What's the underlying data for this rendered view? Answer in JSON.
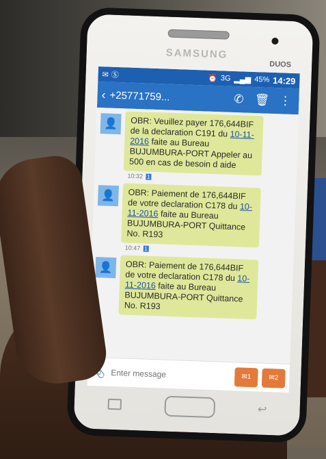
{
  "phone": {
    "brand": "SAMSUNG",
    "model_badge": "DUOS"
  },
  "status_bar": {
    "battery": "45%",
    "time": "14:29",
    "network": "3G"
  },
  "toolbar": {
    "back": "‹",
    "contact": "+25771759...",
    "icons": [
      "phone-icon",
      "trash-icon",
      "more-icon"
    ]
  },
  "messages": [
    {
      "lines_before_date": "OBR: Veuillez payer 176,644BIF de la declaration C191 du ",
      "date": "10-11-2016",
      "lines_after_date": " faite au Bureau BUJUMBURA-PORT Appeler au 500 en cas de besoin d aide",
      "time": "10:32"
    },
    {
      "lines_before_date": "OBR: Paiement de 176,644BIF de votre declaration C178 du ",
      "date": "10-11-2016",
      "lines_after_date": " faite au Bureau BUJUMBURA-PORT Quittance No. R193",
      "time": "10:47"
    },
    {
      "lines_before_date": "OBR: Paiement de 176,644BIF de votre declaration C178 du ",
      "date": "10-11-2016",
      "lines_after_date": " faite au Bureau BUJUMBURA-PORT Quittance No. R193",
      "time": ""
    }
  ],
  "input": {
    "placeholder": "Enter message"
  }
}
